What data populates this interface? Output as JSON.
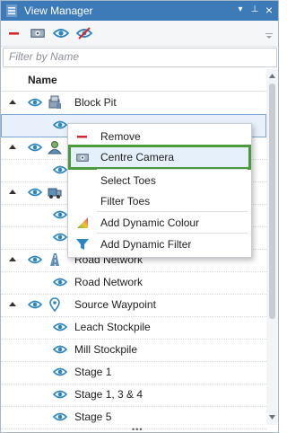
{
  "window": {
    "title": "View Manager",
    "pin_glyph": "⊥",
    "close_glyph": "×",
    "menu_glyph": "▾"
  },
  "toolbar": {
    "icons": [
      "minus-icon",
      "camera-icon",
      "eye-icon",
      "eye-off-icon"
    ],
    "overflow_icon": "chevron-down-icon"
  },
  "filter": {
    "placeholder": "Filter by Name",
    "value": ""
  },
  "tree": {
    "column_header": "Name",
    "rows": [
      {
        "label": "Block Pit",
        "level": 0,
        "expanded": true
      },
      {
        "label": "",
        "level": 1,
        "selected": true
      },
      {
        "label": "",
        "level": 0,
        "expanded": true
      },
      {
        "label": "",
        "level": 1
      },
      {
        "label": "",
        "level": 0,
        "expanded": true
      },
      {
        "label": "",
        "level": 1
      },
      {
        "label": "",
        "level": 1
      },
      {
        "label": "Road Network",
        "level": 0,
        "expanded": true
      },
      {
        "label": "Road Network",
        "level": 1
      },
      {
        "label": "Source Waypoint",
        "level": 0,
        "expanded": true
      },
      {
        "label": "Leach Stockpile",
        "level": 1
      },
      {
        "label": "Mill Stockpile",
        "level": 1
      },
      {
        "label": "Stage 1",
        "level": 1
      },
      {
        "label": "Stage 1, 3 & 4",
        "level": 1
      },
      {
        "label": "Stage 5",
        "level": 1
      }
    ]
  },
  "context_menu": {
    "items": [
      {
        "label": "Remove",
        "icon": "minus-icon"
      },
      {
        "label": "Centre Camera",
        "icon": "camera-icon",
        "highlighted": true
      },
      {
        "label": "Select Toes",
        "icon": ""
      },
      {
        "label": "Filter Toes",
        "icon": ""
      },
      {
        "label": "Add Dynamic Colour",
        "icon": "colour-gradient-icon"
      },
      {
        "label": "Add Dynamic Filter",
        "icon": "funnel-icon"
      }
    ]
  },
  "colors": {
    "title_bar": "#3d7ab8",
    "accent_blue": "#2e86c1",
    "remove_red": "#d9262c",
    "highlight_green": "#4a9a3d"
  },
  "grip": "•••"
}
